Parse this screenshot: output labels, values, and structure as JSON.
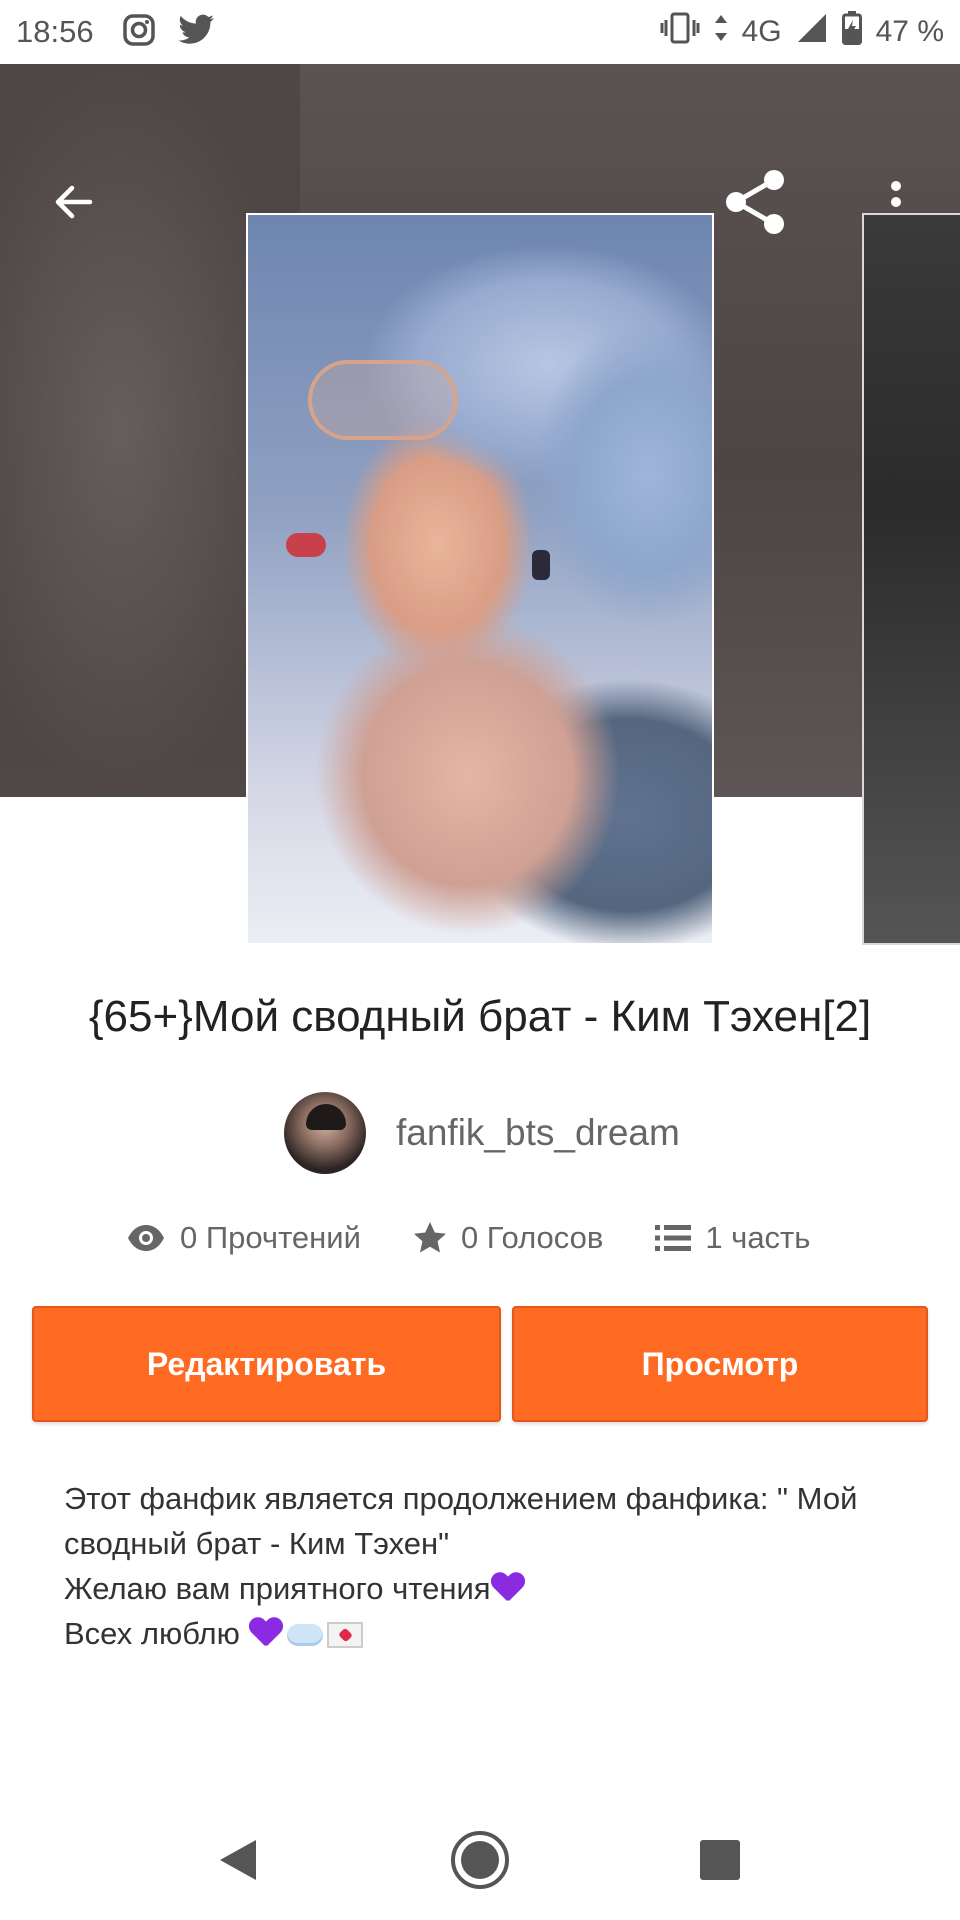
{
  "status_bar": {
    "time": "18:56",
    "network": "4G",
    "battery": "47 %",
    "left_icons": [
      "instagram-icon",
      "twitter-icon"
    ],
    "right_icons": [
      "vibrate-icon",
      "data-arrows-icon",
      "signal-icon",
      "battery-icon"
    ]
  },
  "toolbar": {
    "back_icon": "arrow-left-icon",
    "share_icon": "share-icon",
    "more_icon": "more-vertical-icon"
  },
  "story": {
    "title": "{65+}Мой сводный брат - Ким Тэхен[2]",
    "author": "fanfik_bts_dream",
    "stats": {
      "reads": "0 Прочтений",
      "votes": "0 Голосов",
      "parts": "1 часть"
    },
    "description_lines": [
      "Этот фанфик является продолжением фанфика: \" Мой",
      "сводный брат - Ким Тэхен\"",
      "Желаю вам приятного чтения",
      "Всех люблю "
    ]
  },
  "actions": {
    "edit_label": "Редактировать",
    "view_label": "Просмотр"
  },
  "colors": {
    "accent": "#ff6a22",
    "text_primary": "#222222",
    "text_secondary": "#666666"
  },
  "nav_bar": {
    "icons": [
      "nav-back-icon",
      "nav-home-icon",
      "nav-recents-icon"
    ]
  }
}
